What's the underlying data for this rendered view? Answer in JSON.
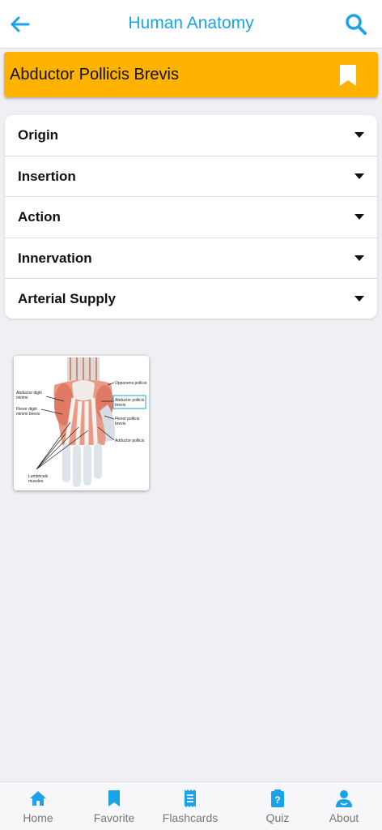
{
  "app": {
    "title": "Human Anatomy",
    "accent_color": "#1aa3e8"
  },
  "header": {
    "back_icon": "arrow-left-icon",
    "search_icon": "search-icon"
  },
  "muscle": {
    "name": "Abductor Pollicis Brevis",
    "banner_color": "#ffb300",
    "bookmark_icon": "bookmark-icon"
  },
  "sections": [
    {
      "label": "Origin"
    },
    {
      "label": "Insertion"
    },
    {
      "label": "Action"
    },
    {
      "label": "Innervation"
    },
    {
      "label": "Arterial Supply"
    }
  ],
  "figure": {
    "labels": {
      "opponens_pollicis": "Opponens pollicis",
      "abductor_digiti_minimi_1": "Abductor digiti",
      "abductor_digiti_minimi_2": "minimi",
      "abductor_pollicis_brevis_1": "Abductor pollicis",
      "abductor_pollicis_brevis_2": "brevis",
      "flexor_digiti_minimi_1": "Flexor digiti",
      "flexor_digiti_minimi_2": "minimi brevis",
      "flexor_pollicis_brevis_1": "Flexor pollicis",
      "flexor_pollicis_brevis_2": "brevis",
      "adductor_pollicis": "Adductor pollicis",
      "lumbricals_1": "Lumbricals",
      "lumbricals_2": "muscles"
    }
  },
  "bottom_nav": {
    "items": [
      {
        "label": "Home",
        "icon": "home-icon"
      },
      {
        "label": "Favorite",
        "icon": "bookmark-icon"
      },
      {
        "label": "Flashcards",
        "icon": "flashcards-icon"
      },
      {
        "label": "Quiz",
        "icon": "quiz-icon"
      },
      {
        "label": "About",
        "icon": "about-icon"
      }
    ]
  }
}
